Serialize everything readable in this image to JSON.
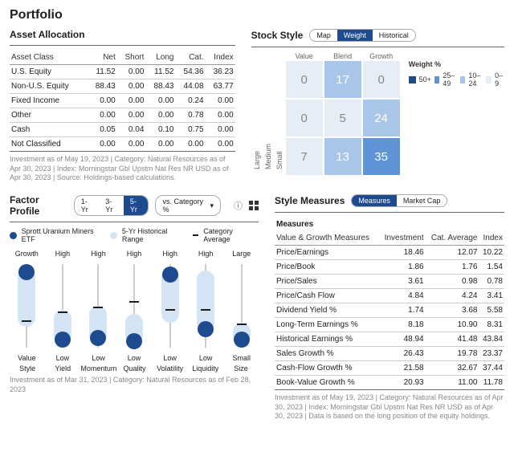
{
  "title": "Portfolio",
  "allocation": {
    "heading": "Asset Allocation",
    "cols": [
      "Asset Class",
      "Net",
      "Short",
      "Long",
      "Cat.",
      "Index"
    ],
    "rows": [
      [
        "U.S. Equity",
        "11.52",
        "0.00",
        "11.52",
        "54.36",
        "36.23"
      ],
      [
        "Non-U.S. Equity",
        "88.43",
        "0.00",
        "88.43",
        "44.08",
        "63.77"
      ],
      [
        "Fixed Income",
        "0.00",
        "0.00",
        "0.00",
        "0.24",
        "0.00"
      ],
      [
        "Other",
        "0.00",
        "0.00",
        "0.00",
        "0.78",
        "0.00"
      ],
      [
        "Cash",
        "0.05",
        "0.04",
        "0.10",
        "0.75",
        "0.00"
      ],
      [
        "Not Classified",
        "0.00",
        "0.00",
        "0.00",
        "0.00",
        "0.00"
      ]
    ],
    "footnote": "Investment as of May 19, 2023 | Category: Natural Resources as of Apr 30, 2023 | Index: Morningstar Gbl Upstm Nat Res NR USD as of Apr 30, 2023 | Source: Holdings-based calculations."
  },
  "stockstyle": {
    "heading": "Stock Style",
    "tabs": [
      "Map",
      "Weight",
      "Historical"
    ],
    "active": "Weight",
    "cols": [
      "Value",
      "Blend",
      "Growth"
    ],
    "rows": [
      "Large",
      "Medium",
      "Small"
    ],
    "cells": [
      [
        0,
        17,
        0
      ],
      [
        0,
        5,
        24
      ],
      [
        7,
        13,
        35
      ]
    ],
    "legend_title": "Weight %",
    "legend": [
      [
        "50+",
        "#1e4a8f"
      ],
      [
        "25–49",
        "#5f95d6"
      ],
      [
        "10–24",
        "#a9c5e8"
      ],
      [
        "0–9",
        "#e6edf5"
      ]
    ]
  },
  "factor": {
    "heading": "Factor Profile",
    "tabs": [
      "1-Yr",
      "3-Yr",
      "5-Yr"
    ],
    "active": "5-Yr",
    "dropdown": "vs. Category %",
    "legend": {
      "etf": "Sprott Uranium Miners ETF",
      "range": "5-Yr Historical Range",
      "avg": "Category Average"
    },
    "axes": [
      {
        "name": "Style",
        "top": "Growth",
        "bot": "Value",
        "range": [
          5,
          75
        ],
        "dot": 10,
        "avg": 68
      },
      {
        "name": "Yield",
        "top": "High",
        "bot": "Low",
        "range": [
          55,
          95
        ],
        "dot": 90,
        "avg": 58
      },
      {
        "name": "Momentum",
        "top": "High",
        "bot": "Low",
        "range": [
          50,
          95
        ],
        "dot": 88,
        "avg": 52
      },
      {
        "name": "Quality",
        "top": "High",
        "bot": "Low",
        "range": [
          60,
          95
        ],
        "dot": 92,
        "avg": 45
      },
      {
        "name": "Volatility",
        "top": "High",
        "bot": "Low",
        "range": [
          5,
          70
        ],
        "dot": 12,
        "avg": 55
      },
      {
        "name": "Liquidity",
        "top": "High",
        "bot": "Low",
        "range": [
          8,
          80
        ],
        "dot": 78,
        "avg": 55
      },
      {
        "name": "Size",
        "top": "Large",
        "bot": "Small",
        "range": [
          70,
          95
        ],
        "dot": 90,
        "avg": 72
      }
    ],
    "footnote": "Investment as of Mar 31, 2023 | Category: Natural Resources as of Feb 28, 2023"
  },
  "measures": {
    "heading": "Style Measures",
    "tabs": [
      "Measures",
      "Market Cap"
    ],
    "active": "Measures",
    "subhead": "Measures",
    "cols": [
      "Value & Growth Measures",
      "Investment",
      "Cat. Average",
      "Index"
    ],
    "rows": [
      [
        "Price/Earnings",
        "18.46",
        "12.07",
        "10.22"
      ],
      [
        "Price/Book",
        "1.86",
        "1.76",
        "1.54"
      ],
      [
        "Price/Sales",
        "3.61",
        "0.98",
        "0.78"
      ],
      [
        "Price/Cash Flow",
        "4.84",
        "4.24",
        "3.41"
      ],
      [
        "Dividend Yield %",
        "1.74",
        "3.68",
        "5.58"
      ],
      [
        "Long-Term Earnings %",
        "8.18",
        "10.90",
        "8.31"
      ],
      [
        "Historical Earnings %",
        "48.94",
        "41.48",
        "43.84"
      ],
      [
        "Sales Growth %",
        "26.43",
        "19.78",
        "23.37"
      ],
      [
        "Cash-Flow Growth %",
        "21.58",
        "32.67",
        "37.44"
      ],
      [
        "Book-Value Growth %",
        "20.93",
        "11.00",
        "11.78"
      ]
    ],
    "footnote": "Investment as of May 19, 2023 | Category: Natural Resources as of Apr 30, 2023 | Index: Morningstar Gbl Upstm Nat Res NR USD as of Apr 30, 2023 | Data is based on the long position of the equity holdings."
  },
  "chart_data": {
    "type": "table",
    "title": "Stock Style Weight %",
    "columns": [
      "Value",
      "Blend",
      "Growth"
    ],
    "rows": [
      "Large",
      "Medium",
      "Small"
    ],
    "values": [
      [
        0,
        17,
        0
      ],
      [
        0,
        5,
        24
      ],
      [
        7,
        13,
        35
      ]
    ]
  }
}
